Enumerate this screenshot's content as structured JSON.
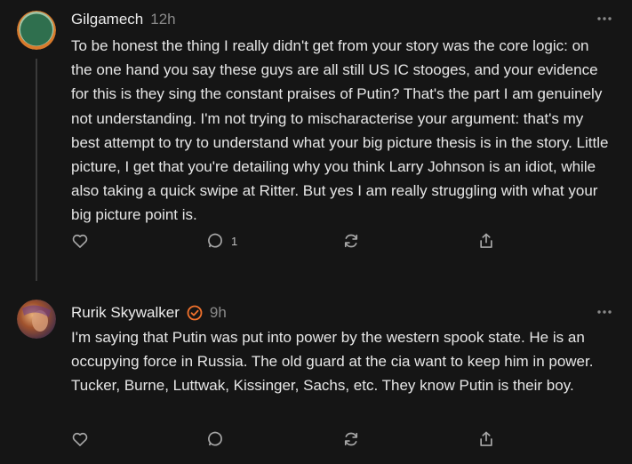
{
  "comments": [
    {
      "author": "Gilgamech",
      "time": "12h",
      "text": "To be honest the thing I really didn't get from your story was the core logic: on the one hand you say these guys are all still US IC stooges, and your evidence for this is they sing the constant praises of Putin? That's the part I am genuinely not understanding. I'm not trying to mischaracterise your argument: that's my best attempt to try to understand what your big picture thesis is in the story. Little picture, I get that you're detailing why you think Larry Johnson is an idiot, while also taking a quick swipe at Ritter. But yes I am really struggling with what your big picture point is.",
      "reply_count": "1",
      "avatar_colors": [
        "#2f6f4e",
        "#d87a2c"
      ]
    },
    {
      "author": "Rurik Skywalker",
      "time": "9h",
      "verified_color": "#f0712c",
      "text": "I'm saying that Putin was put into power by the western spook state. He is an occupying force in Russia. The old guard at the cia want to keep him in power. Tucker, Burne, Luttwak, Kissinger, Sachs, etc. They know Putin is their boy.",
      "reply_count": "",
      "avatar_colors": [
        "#a0522d",
        "#6a3b8a"
      ]
    }
  ],
  "icons": {
    "like": "heart-icon",
    "reply": "comment-bubble-icon",
    "restack": "restack-icon",
    "share": "share-icon",
    "more": "more-options-icon",
    "verified": "verified-badge-icon"
  },
  "colors": {
    "background": "#151515",
    "text": "#e6e6e6",
    "muted": "#8a8a8a",
    "icon": "#a8a8a8"
  }
}
